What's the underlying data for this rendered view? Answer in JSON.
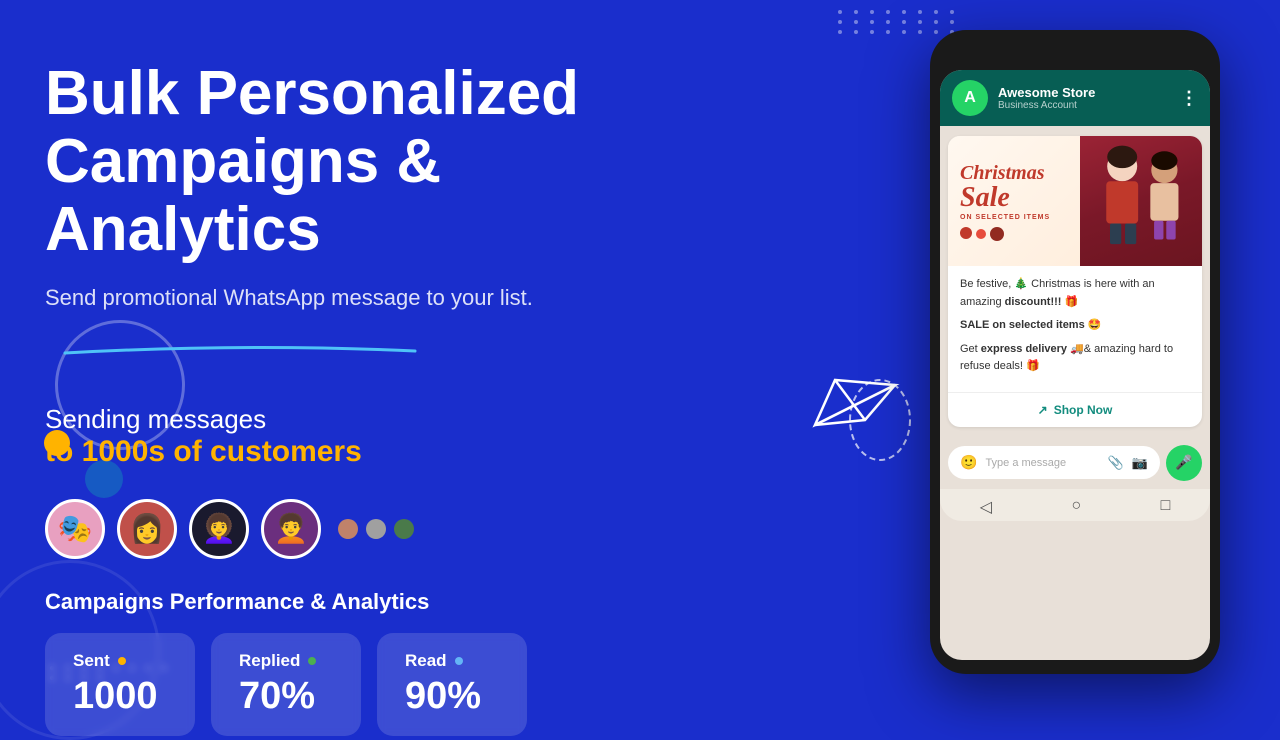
{
  "hero": {
    "title_line1": "Bulk Personalized",
    "title_line2": "Campaigns & Analytics",
    "subtitle": "Send promotional WhatsApp message to your list."
  },
  "sending": {
    "line1": "Sending messages",
    "line2": "to 1000s of customers"
  },
  "analytics": {
    "title": "Campaigns Performance & Analytics",
    "stats": [
      {
        "label": "Sent",
        "value": "1000",
        "dot_color": "orange"
      },
      {
        "label": "Replied",
        "value": "70%",
        "dot_color": "green"
      },
      {
        "label": "Read",
        "value": "90%",
        "dot_color": "blue"
      }
    ]
  },
  "phone": {
    "store_name": "Awesome Store",
    "account_type": "Business Account",
    "store_initial": "A",
    "promo_image_alt": "Christmas Sale on selected items",
    "christmas_text": "Christmas",
    "sale_word": "Sale",
    "on_selected": "ON SELECTED ITEMS",
    "message_line1": "Be festive, 🎄 Christmas is here with an amazing",
    "message_bold1": "discount!!!",
    "message_emoji1": "🎁",
    "message_line2": "SALE on selected items 🤩",
    "message_line3": "Get",
    "message_bold2": "express delivery",
    "message_line3b": "🚚& amazing hard to refuse deals! 🎁",
    "shop_now": "Shop Now",
    "input_placeholder": "Type a message"
  },
  "colors": {
    "background": "#1a2ecc",
    "orange_accent": "#ffb300",
    "white": "#ffffff",
    "wa_green": "#075e54",
    "wa_light_green": "#25d366"
  }
}
